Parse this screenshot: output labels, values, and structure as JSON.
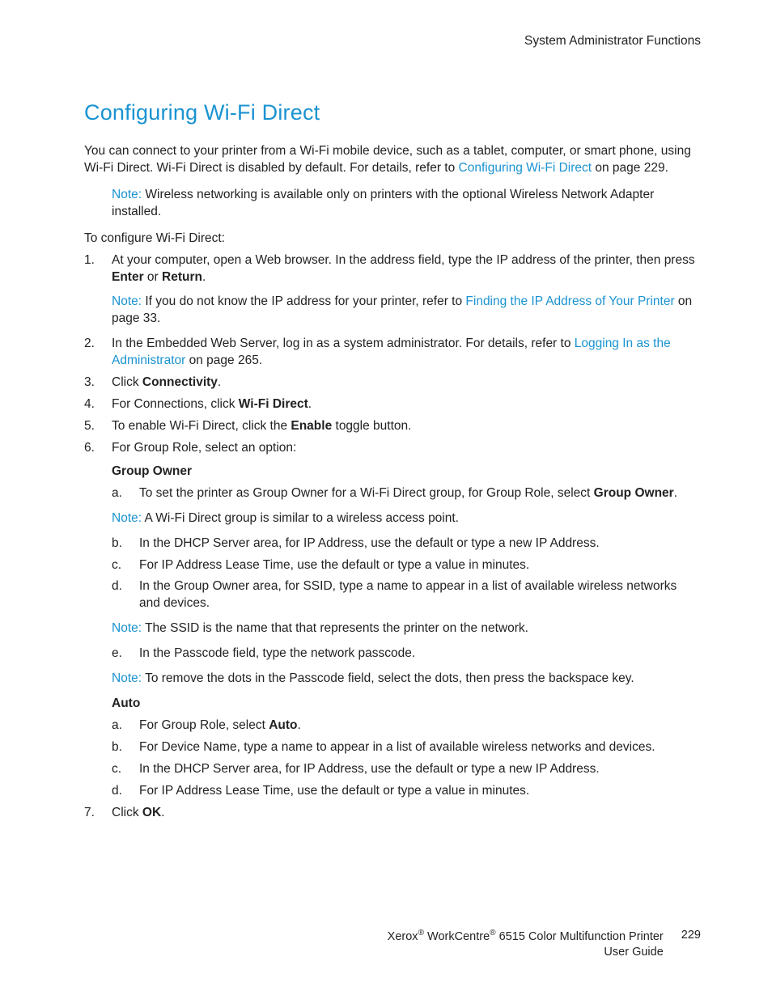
{
  "header": {
    "section": "System Administrator Functions"
  },
  "title": "Configuring Wi-Fi Direct",
  "intro": {
    "pre": "You can connect to your printer from a Wi-Fi mobile device, such as a tablet, computer, or smart phone, using Wi-Fi Direct. Wi-Fi Direct is disabled by default. For details, refer to ",
    "link": "Configuring Wi-Fi Direct",
    "post": " on page 229."
  },
  "note_top": {
    "lead": "Note:",
    "text": " Wireless networking is available only on printers with the optional Wireless Network Adapter installed."
  },
  "lead": "To configure Wi-Fi Direct:",
  "steps": {
    "s1": {
      "pre": "At your computer, open a Web browser. In the address field, type the IP address of the printer, then press ",
      "b1": "Enter",
      "mid": " or ",
      "b2": "Return",
      "post": ".",
      "note": {
        "lead": "Note:",
        "pre": " If you do not know the IP address for your printer, refer to ",
        "link": "Finding the IP Address of Your Printer",
        "post": " on page 33."
      }
    },
    "s2": {
      "pre": "In the Embedded Web Server, log in as a system administrator. For details, refer to ",
      "link": "Logging In as the Administrator",
      "post": " on page 265."
    },
    "s3": {
      "pre": "Click ",
      "b": "Connectivity",
      "post": "."
    },
    "s4": {
      "pre": "For Connections, click ",
      "b": "Wi-Fi Direct",
      "post": "."
    },
    "s5": {
      "pre": "To enable Wi-Fi Direct, click the ",
      "b": "Enable",
      "post": " toggle button."
    },
    "s6": {
      "text": "For Group Role, select an option:",
      "group_owner_head": "Group Owner",
      "go": {
        "a": {
          "pre": "To set the printer as Group Owner for a Wi-Fi Direct group, for Group Role, select ",
          "b": "Group Owner",
          "post": "."
        },
        "note_a": {
          "lead": "Note:",
          "text": " A Wi-Fi Direct group is similar to a wireless access point."
        },
        "b": "In the DHCP Server area, for IP Address, use the default or type a new IP Address.",
        "c": "For IP Address Lease Time, use the default or type a value in minutes.",
        "d": "In the Group Owner area, for SSID, type a name to appear in a list of available wireless networks and devices.",
        "note_d": {
          "lead": "Note:",
          "text": " The SSID is the name that that represents the printer on the network."
        },
        "e": "In the Passcode field, type the network passcode.",
        "note_e": {
          "lead": "Note:",
          "text": " To remove the dots in the Passcode field, select the dots, then press the backspace key."
        }
      },
      "auto_head": "Auto",
      "auto": {
        "a": {
          "pre": "For Group Role, select ",
          "b": "Auto",
          "post": "."
        },
        "b": "For Device Name, type a name to appear in a list of available wireless networks and devices.",
        "c": "In the DHCP Server area, for IP Address, use the default or type a new IP Address.",
        "d": "For IP Address Lease Time, use the default or type a value in minutes."
      }
    },
    "s7": {
      "pre": "Click ",
      "b": "OK",
      "post": "."
    }
  },
  "footer": {
    "line1_pre": "Xerox",
    "line1_reg1": "®",
    "line1_mid": " WorkCentre",
    "line1_reg2": "®",
    "line1_post": " 6515 Color Multifunction Printer",
    "line2": "User Guide",
    "page": "229"
  }
}
